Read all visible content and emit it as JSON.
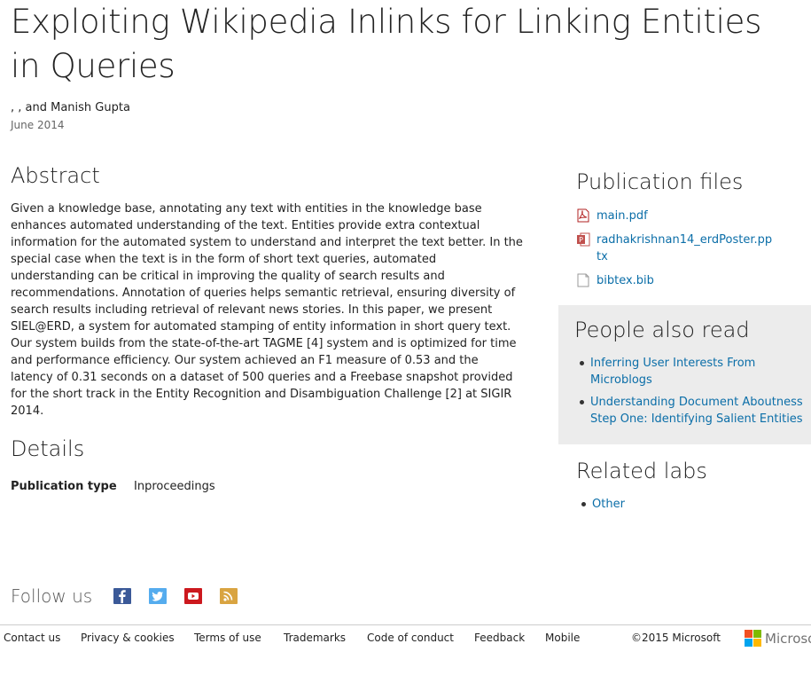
{
  "publication": {
    "title": "Exploiting Wikipedia Inlinks for Linking Entities in Queries",
    "authors": ", , and Manish Gupta",
    "date": "June 2014"
  },
  "abstract": {
    "heading": "Abstract",
    "text": "Given a knowledge base, annotating any text with entities in the knowledge base enhances automated understanding of the text. Entities provide extra contextual information for the automated system to understand and interpret the text better. In the special case when the text is in the form of short text queries, automated understanding can be critical in improving the quality of search results and recommendations. Annotation of queries helps semantic retrieval, ensuring diversity of search results including retrieval of relevant news stories. In this paper, we present SIEL@ERD, a system for automated stamping of entity information in short query text. Our system builds from the state-of-the-art TAGME [4] system and is optimized for time and performance efficiency. Our system achieved an F1 measure of 0.53 and the latency of 0.31 seconds on a dataset of 500 queries and a Freebase snapshot provided for the short track in the Entity Recognition and Disambiguation Challenge [2] at SIGIR 2014."
  },
  "details": {
    "heading": "Details",
    "rows": [
      {
        "key": "Publication type",
        "value": "Inproceedings"
      }
    ]
  },
  "publication_files": {
    "heading": "Publication files",
    "files": [
      {
        "name": "main.pdf",
        "icon": "pdf-icon"
      },
      {
        "name": "radhakrishnan14_erdPoster.pptx",
        "icon": "pptx-icon"
      },
      {
        "name": "bibtex.bib",
        "icon": "file-icon"
      }
    ]
  },
  "people_also_read": {
    "heading": "People also read",
    "items": [
      "Inferring User Interests From Microblogs",
      "Understanding Document Aboutness Step One: Identifying Salient Entities"
    ]
  },
  "related_labs": {
    "heading": "Related labs",
    "items": [
      "Other"
    ]
  },
  "follow": {
    "label": "Follow us",
    "icons": [
      "facebook-icon",
      "twitter-icon",
      "youtube-icon",
      "rss-icon"
    ]
  },
  "footer": {
    "links": [
      "Contact us",
      "Privacy & cookies",
      "Terms of use",
      "Trademarks",
      "Code of conduct",
      "Feedback",
      "Mobile"
    ],
    "copyright": "©2015 Microsoft",
    "logo_text": "Microsoft"
  },
  "colors": {
    "link": "#0b6ea8",
    "sidebar_box": "#ececec",
    "facebook": "#3b5998",
    "twitter": "#55acee",
    "youtube": "#cc181e",
    "rss": "#d9a441"
  }
}
